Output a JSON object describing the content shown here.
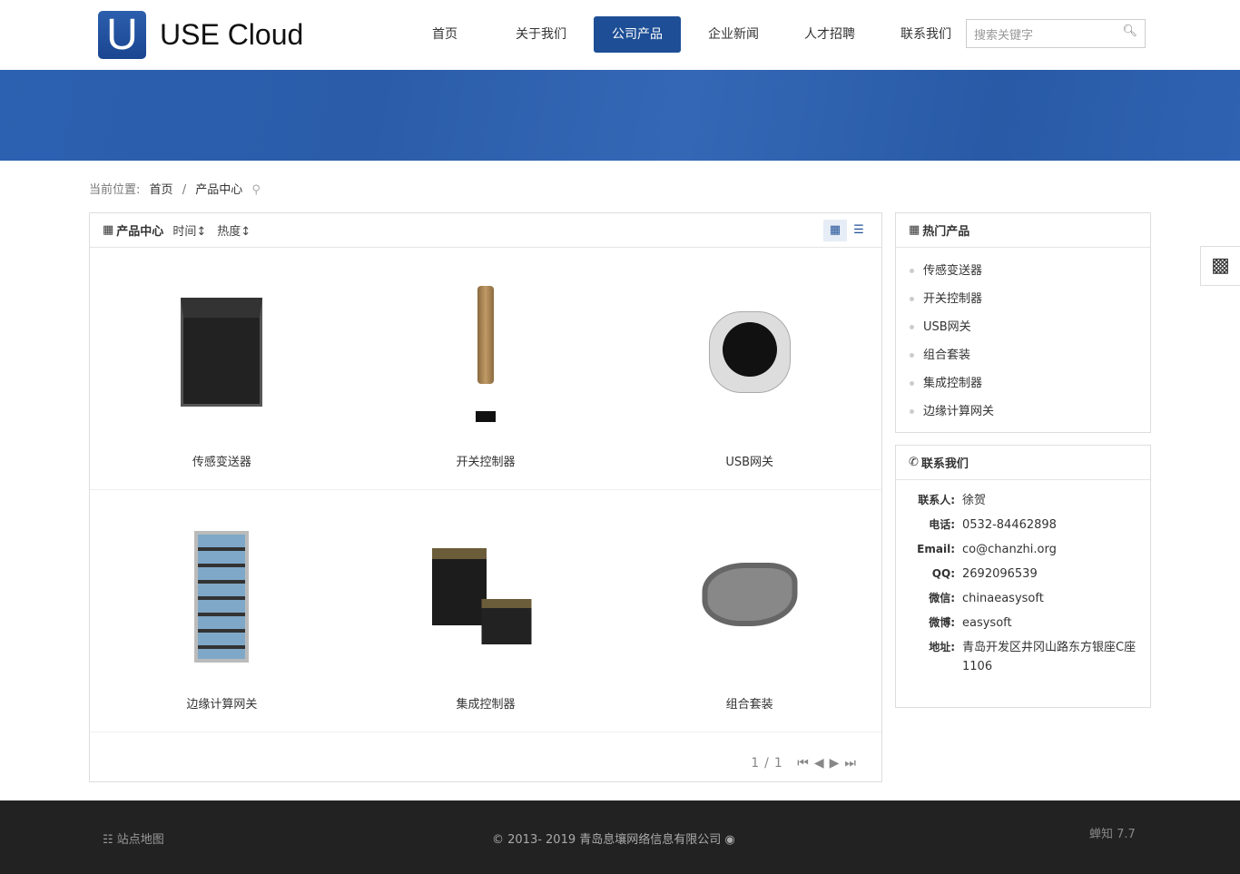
{
  "brand": {
    "logo_letter": "U",
    "name": "USE Cloud"
  },
  "nav": [
    {
      "label": "首页"
    },
    {
      "label": "关于我们"
    },
    {
      "label": "公司产品",
      "active": true
    },
    {
      "label": "企业新闻"
    },
    {
      "label": "人才招聘"
    },
    {
      "label": "联系我们"
    }
  ],
  "search": {
    "placeholder": "搜索关键字"
  },
  "breadcrumb": {
    "prefix": "当前位置:",
    "items": [
      "首页",
      "/",
      "产品中心"
    ]
  },
  "products": {
    "title": "产品中心",
    "sort_time": "时间",
    "sort_hot": "热度",
    "items": [
      {
        "name": "传感变送器"
      },
      {
        "name": "开关控制器"
      },
      {
        "name": "USB网关"
      },
      {
        "name": "边缘计算网关"
      },
      {
        "name": "集成控制器"
      },
      {
        "name": "组合套装"
      }
    ],
    "pager": "1/1"
  },
  "hot": {
    "title": "热门产品",
    "items": [
      "传感变送器",
      "开关控制器",
      "USB网关",
      "组合套装",
      "集成控制器",
      "边缘计算网关"
    ]
  },
  "contact": {
    "title": "联系我们",
    "rows": [
      {
        "k": "联系人:",
        "v": "徐贺"
      },
      {
        "k": "电话:",
        "v": "0532-84462898"
      },
      {
        "k": "Email:",
        "v": "co@chanzhi.org"
      },
      {
        "k": "QQ:",
        "v": "2692096539"
      },
      {
        "k": "微信:",
        "v": "chinaeasysoft"
      },
      {
        "k": "微博:",
        "v": "easysoft"
      },
      {
        "k": "地址:",
        "v": "青岛开发区井冈山路东方银座C座 1106"
      }
    ]
  },
  "footer": {
    "sitemap": "站点地图",
    "copyright": "© 2013- 2019 青岛息壤网络信息有限公司",
    "powered": "蝉知 7.7"
  }
}
